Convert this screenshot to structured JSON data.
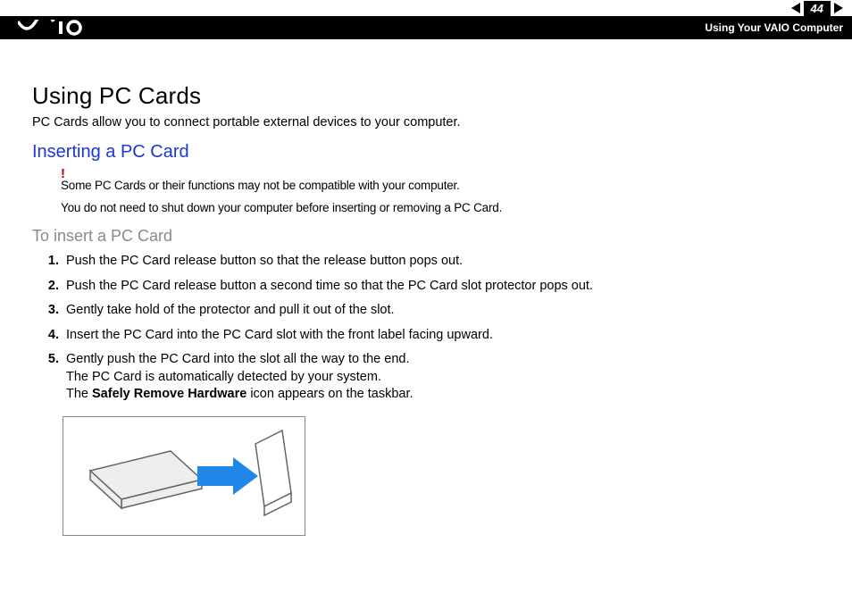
{
  "nav": {
    "page_number": "44",
    "section_title": "Using Your VAIO Computer"
  },
  "title": "Using PC Cards",
  "intro": "PC Cards allow you to connect portable external devices to your computer.",
  "subheading": "Inserting a PC Card",
  "warning_mark": "!",
  "warning_lines": [
    "Some PC Cards or their functions may not be compatible with your computer.",
    "You do not need to shut down your computer before inserting or removing a PC Card."
  ],
  "procedure_heading": "To insert a PC Card",
  "steps": [
    {
      "text": "Push the PC Card release button so that the release button pops out."
    },
    {
      "text": "Push the PC Card release button a second time so that the PC Card slot protector pops out."
    },
    {
      "text": "Gently take hold of the protector and pull it out of the slot."
    },
    {
      "text": "Insert the PC Card into the PC Card slot with the front label facing upward."
    },
    {
      "text": "Gently push the PC Card into the slot all the way to the end.",
      "detail_a": "The PC Card is automatically detected by your system.",
      "detail_b_pre": "The ",
      "detail_b_bold": "Safely Remove Hardware",
      "detail_b_post": " icon appears on the taskbar."
    }
  ]
}
